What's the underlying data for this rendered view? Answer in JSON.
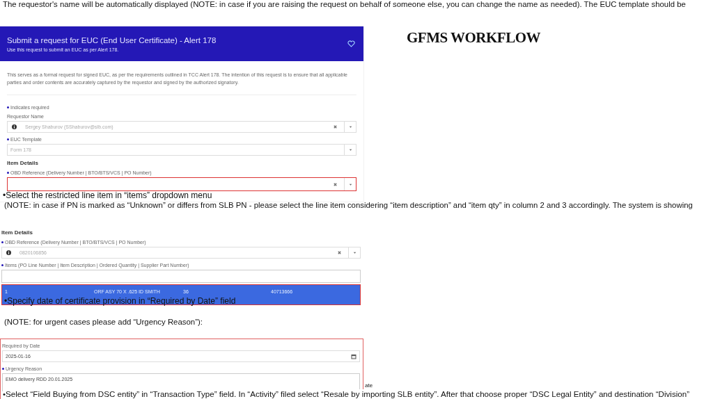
{
  "top_note": "The requestor's name will be automatically displayed (NOTE: in case if you are raising the request on behalf of someone else, you can change the name as needed). The EUC template should be",
  "slide_title": "GFMS WORKFLOW",
  "form": {
    "title": "Submit a request for EUC (End User Certificate) - Alert 178",
    "subtitle": "Use this request to submit an EUC as per Alert 178.",
    "intro": "This serves as a formal request for signed EUC, as per the requirements outlined in TCC Alert 178. The intention of this request is to ensure that all applicable parties and order contents are accurately captured by the requestor and signed by the authorized signatory.",
    "legend": "Indicates required",
    "requestor_label": "Requestor Name",
    "requestor_value": "Sergey Shaburov (SShaburov@slb.com)",
    "template_label": "EUC Template",
    "template_value": "Form 178",
    "section": "Item Details",
    "obd_label": "OBD Reference (Delivery Number | BTO/BTS/VCS | PO Number)"
  },
  "step_1": {
    "caption": "•Select the restricted line item in “items” dropdown menu",
    "note": "(NOTE: in case if PN is marked as “Unknown” or differs from SLB PN - please select the line item considering “item description” and “item qty” in column 2 and 3 accordingly. The system is showing"
  },
  "items_panel": {
    "section": "Item Details",
    "obd_label": "OBD Reference (Delivery Number | BTO/BTS/VCS | PO Number)",
    "obd_value": "0820106856",
    "items_label": "Items (PO Line Number | Item Description | Ordered Quantity | Supplier Part Number)",
    "options": [
      {
        "cells": [
          "1",
          "ORF ASY 70 X .625 ID SMITH",
          "36",
          "40713666"
        ],
        "selected": true
      }
    ]
  },
  "step_2": {
    "caption": "•Specify date of certificate provision in “Required by Date” field",
    "note": "(NOTE: for urgent cases please add “Urgency Reason”):"
  },
  "date_panel": {
    "date_label": "Required by Date",
    "date_value": "2025-01-16",
    "reason_label": "Urgency Reason",
    "reason_value": "EMO delivery RDD 20.01.2025"
  },
  "fragment": "ate",
  "step_3": {
    "caption": "•Select “Field Buying from DSC entity” in “Transaction Type” field. In “Activity” filed select “Resale by importing SLB entity”. After that choose proper “DSC Legal Entity” and destination “Division”"
  }
}
